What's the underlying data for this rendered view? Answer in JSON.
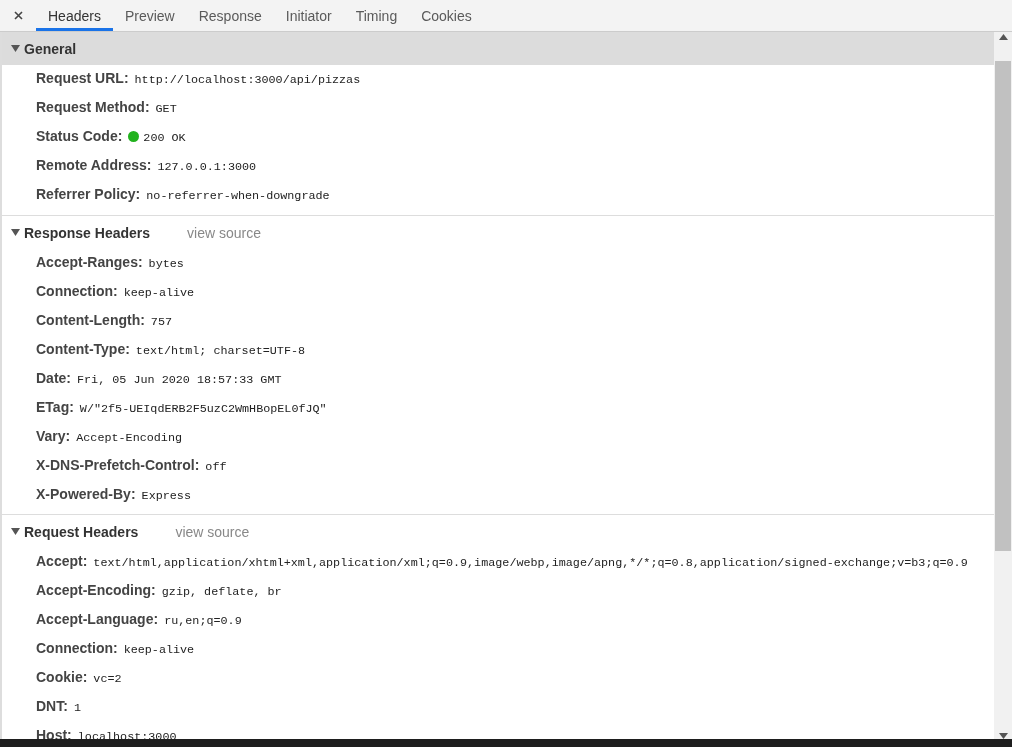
{
  "tabs": [
    {
      "label": "Headers",
      "selected": true
    },
    {
      "label": "Preview",
      "selected": false
    },
    {
      "label": "Response",
      "selected": false
    },
    {
      "label": "Initiator",
      "selected": false
    },
    {
      "label": "Timing",
      "selected": false
    },
    {
      "label": "Cookies",
      "selected": false
    }
  ],
  "sections": [
    {
      "title": "General",
      "expanded": true,
      "highlighted": true,
      "rows": [
        {
          "name": "Request URL:",
          "value": "http://localhost:3000/api/pizzas"
        },
        {
          "name": "Request Method:",
          "value": "GET"
        },
        {
          "name": "Status Code:",
          "value": "200 OK",
          "color": "#22b21e"
        },
        {
          "name": "Remote Address:",
          "value": "127.0.0.1:3000"
        },
        {
          "name": "Referrer Policy:",
          "value": "no-referrer-when-downgrade"
        }
      ]
    },
    {
      "title": "Response Headers",
      "link": "view source",
      "expanded": true,
      "highlighted": false,
      "rows": [
        {
          "name": "Accept-Ranges:",
          "value": "bytes"
        },
        {
          "name": "Connection:",
          "value": "keep-alive"
        },
        {
          "name": "Content-Length:",
          "value": "757"
        },
        {
          "name": "Content-Type:",
          "value": "text/html; charset=UTF-8"
        },
        {
          "name": "Date:",
          "value": "Fri, 05 Jun 2020 18:57:33 GMT"
        },
        {
          "name": "ETag:",
          "value": "W/\"2f5-UEIqdERB2F5uzC2WmHBopEL0fJQ\""
        },
        {
          "name": "Vary:",
          "value": "Accept-Encoding"
        },
        {
          "name": "X-DNS-Prefetch-Control:",
          "value": "off"
        },
        {
          "name": "X-Powered-By:",
          "value": "Express"
        }
      ]
    },
    {
      "title": "Request Headers",
      "link": "view source",
      "expanded": true,
      "highlighted": false,
      "rows": [
        {
          "name": "Accept:",
          "value": "text/html,application/xhtml+xml,application/xml;q=0.9,image/webp,image/apng,*/*;q=0.8,application/signed-exchange;v=b3;q=0.9"
        },
        {
          "name": "Accept-Encoding:",
          "value": "gzip, deflate, br"
        },
        {
          "name": "Accept-Language:",
          "value": "ru,en;q=0.9"
        },
        {
          "name": "Connection:",
          "value": "keep-alive"
        },
        {
          "name": "Cookie:",
          "value": "vc=2"
        },
        {
          "name": "DNT:",
          "value": "1"
        },
        {
          "name": "Host:",
          "value": "localhost:3000"
        }
      ]
    }
  ]
}
